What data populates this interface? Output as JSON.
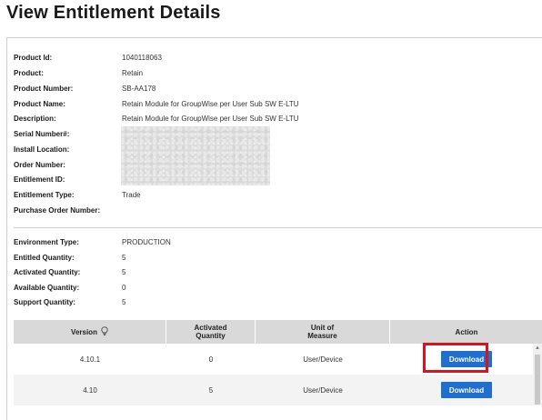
{
  "title": "View Entitlement Details",
  "details": [
    {
      "label": "Product Id:",
      "value": "1040118063"
    },
    {
      "label": "Product:",
      "value": "Retain"
    },
    {
      "label": "Product Number:",
      "value": "SB-AA178"
    },
    {
      "label": "Product Name:",
      "value": "Retain Module for GroupWise per User Sub SW E-LTU"
    },
    {
      "label": "Description:",
      "value": "Retain Module for GroupWise per User Sub SW E-LTU"
    },
    {
      "label": "Serial Number#:",
      "value": ""
    },
    {
      "label": "Install Location:",
      "value": ""
    },
    {
      "label": "Order Number:",
      "value": ""
    },
    {
      "label": "Entitlement ID:",
      "value": ""
    },
    {
      "label": "Entitlement Type:",
      "value": "Trade"
    },
    {
      "label": "Purchase Order Number:",
      "value": ""
    }
  ],
  "quantities": [
    {
      "label": "Environment Type:",
      "value": "PRODUCTION"
    },
    {
      "label": "Entitled Quantity:",
      "value": "5"
    },
    {
      "label": "Activated Quantity:",
      "value": "5"
    },
    {
      "label": "Available Quantity:",
      "value": "0"
    },
    {
      "label": "Support Quantity:",
      "value": "5"
    }
  ],
  "table": {
    "headers": {
      "version": "Version",
      "activated_line1": "Activated",
      "activated_line2": "Quantity",
      "unit_line1": "Unit of",
      "unit_line2": "Measure",
      "action": "Action"
    },
    "rows": [
      {
        "version": "4.10.1",
        "activated": "0",
        "unit": "User/Device",
        "action": "Download"
      },
      {
        "version": "4.10",
        "activated": "5",
        "unit": "User/Device",
        "action": "Download"
      }
    ]
  },
  "colors": {
    "accent": "#1f6fd1",
    "highlight": "#d9131b",
    "header_bg": "#d9d9d9"
  },
  "icons": {
    "version_sort": "lightbulb-icon"
  }
}
